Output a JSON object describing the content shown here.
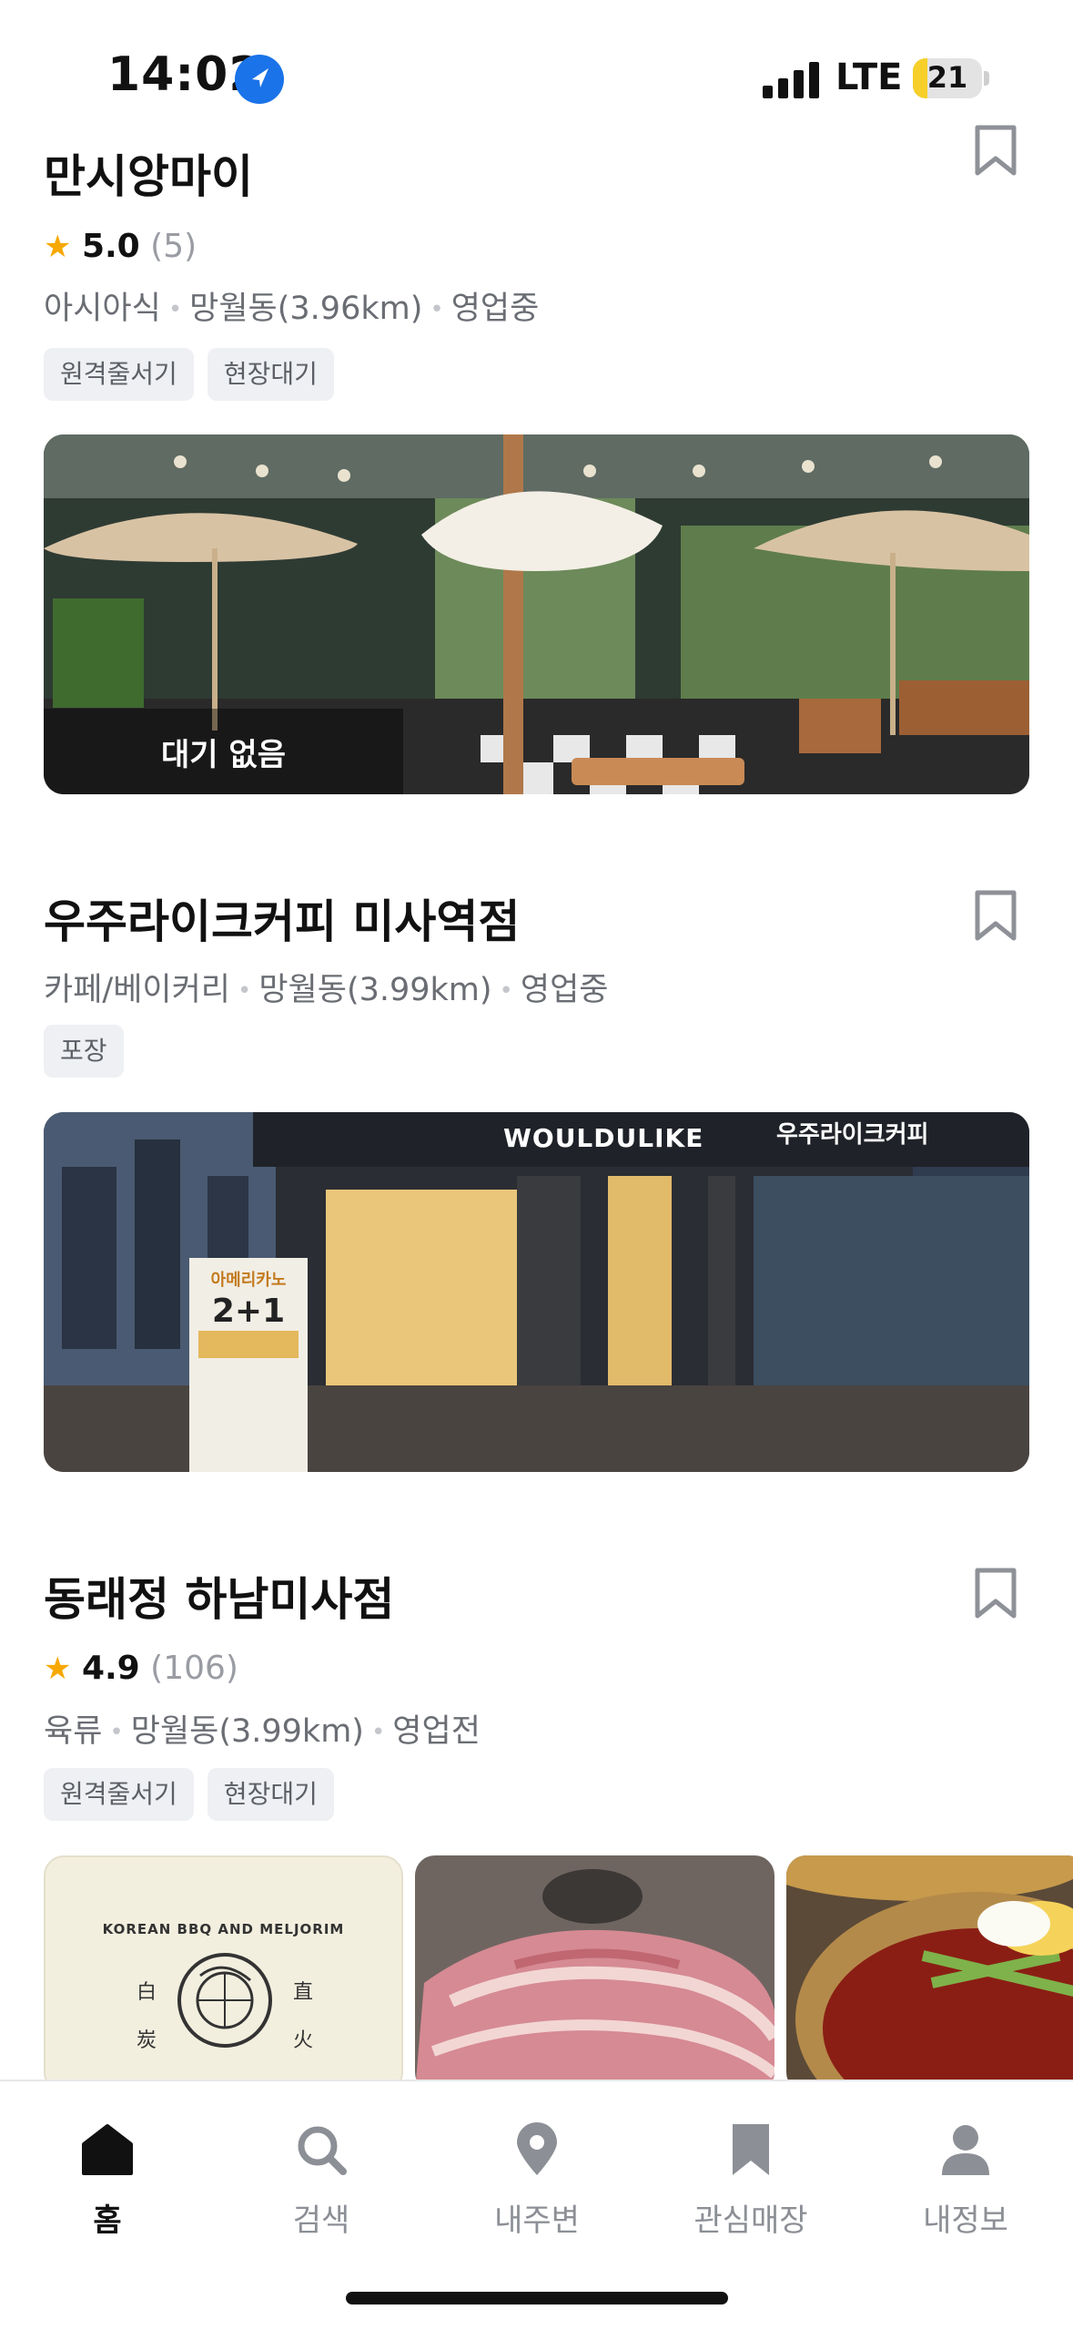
{
  "status_bar": {
    "time": "14:02",
    "network": "LTE",
    "battery": "21",
    "battery_level": 0.21
  },
  "stores": [
    {
      "name": "만시앙마이",
      "rating": "5.0",
      "review_count": "(5)",
      "category": "아시아식",
      "location": "망월동(3.96km)",
      "status": "영업중",
      "tags": [
        "원격줄서기",
        "현장대기"
      ],
      "wait_status": "대기 없음"
    },
    {
      "name": "우주라이크커피 미사역점",
      "category": "카페/베이커리",
      "location": "망월동(3.99km)",
      "status": "영업중",
      "tags": [
        "포장"
      ],
      "sign_text": "WOULDULIKE",
      "sign_text_korean": "우주라이크커피",
      "board_text": "아메리카노",
      "board_promo": "2+1"
    },
    {
      "name": "동래정 하남미사점",
      "rating": "4.9",
      "review_count": "(106)",
      "category": "육류",
      "location": "망월동(3.99km)",
      "status": "영업전",
      "tags": [
        "원격줄서기",
        "현장대기"
      ],
      "logo_text": "KOREAN BBQ AND MELJORIM",
      "logo_chars": [
        "白",
        "直",
        "炭",
        "火"
      ]
    }
  ],
  "bottom_nav": [
    {
      "label": "홈",
      "icon": "home-icon",
      "active": true
    },
    {
      "label": "검색",
      "icon": "search-icon",
      "active": false
    },
    {
      "label": "내주변",
      "icon": "location-pin-icon",
      "active": false
    },
    {
      "label": "관심매장",
      "icon": "bookmark-icon",
      "active": false
    },
    {
      "label": "내정보",
      "icon": "person-icon",
      "active": false
    }
  ],
  "colors": {
    "star": "#f7a800",
    "tag_bg": "#eef0f3",
    "accent": "#1a73e8"
  }
}
